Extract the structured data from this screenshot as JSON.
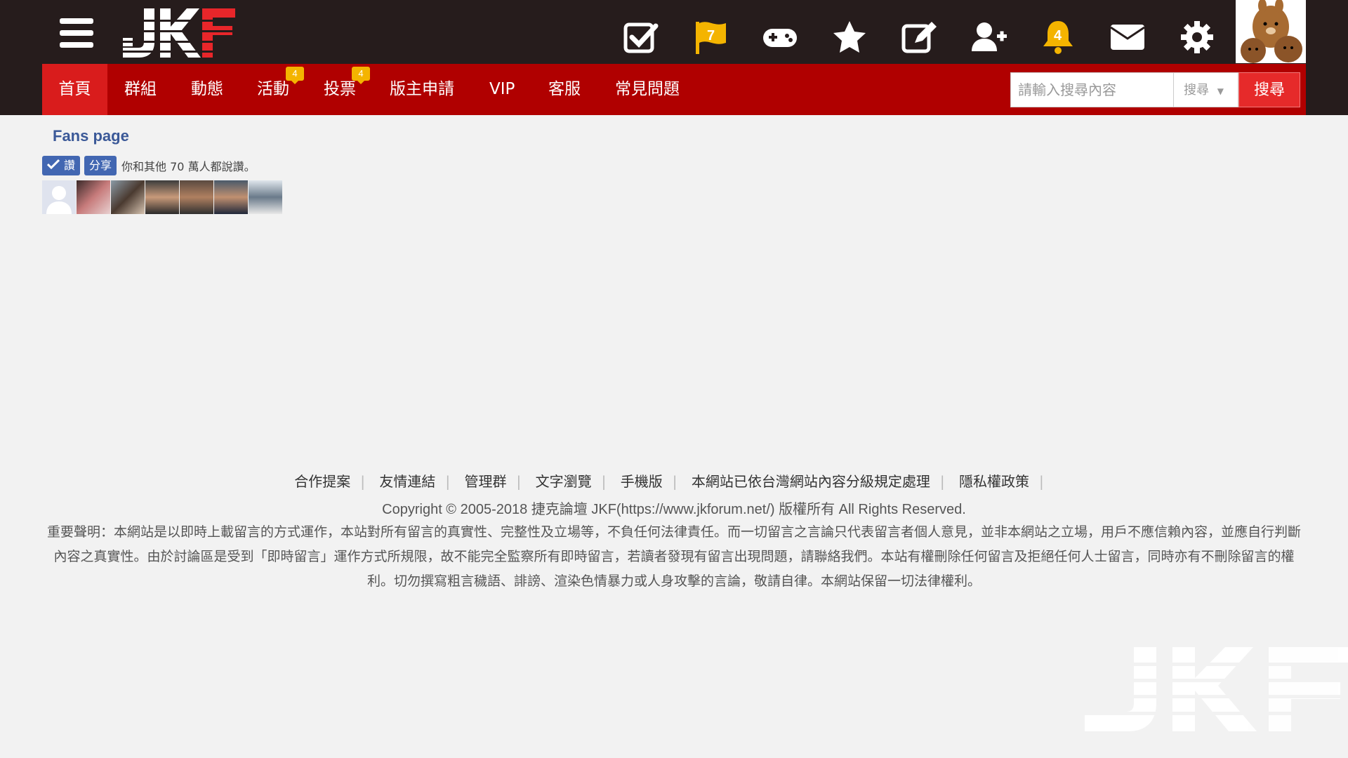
{
  "header": {
    "menu_icon": "hamburger-menu-icon",
    "logo_text": "JKF",
    "flag_badge": "7",
    "bell_badge": "4",
    "icons": [
      "checkbox-icon",
      "flag-icon",
      "gamepad-icon",
      "star-icon",
      "edit-icon",
      "add-friend-icon",
      "bell-icon",
      "mail-icon",
      "gear-icon"
    ]
  },
  "nav": {
    "items": [
      {
        "label": "首頁"
      },
      {
        "label": "群組"
      },
      {
        "label": "動態"
      },
      {
        "label": "活動",
        "badge": "4"
      },
      {
        "label": "投票",
        "badge": "4"
      },
      {
        "label": "版主申請"
      },
      {
        "label": "VIP"
      },
      {
        "label": "客服"
      },
      {
        "label": "常見問題"
      }
    ]
  },
  "search": {
    "placeholder": "請輸入搜尋內容",
    "type": "搜尋",
    "button": "搜尋"
  },
  "fans": {
    "title": "Fans page",
    "like_label": "讚",
    "share_label": "分享",
    "like_text": "你和其他 70 萬人都說讚。"
  },
  "footer": {
    "links": [
      "合作提案",
      "友情連結",
      "管理群",
      "文字瀏覽",
      "手機版",
      "本網站已依台灣網站內容分級規定處理",
      "隱私權政策"
    ],
    "copyright": "Copyright © 2005-2018 捷克論壇 JKF(https://www.jkforum.net/) 版權所有 All Rights Reserved.",
    "disclaimer": "重要聲明：本網站是以即時上載留言的方式運作，本站對所有留言的真實性、完整性及立場等，不負任何法律責任。而一切留言之言論只代表留言者個人意見，並非本網站之立場，用戶不應信賴內容，並應自行判斷內容之真實性。由於討論區是受到「即時留言」運作方式所規限，故不能完全監察所有即時留言，若讀者發現有留言出現問題，請聯絡我們。本站有權刪除任何留言及拒絕任何人士留言，同時亦有不刪除留言的權利。切勿撰寫粗言穢語、誹謗、渲染色情暴力或人身攻擊的言論，敬請自律。本網站保留一切法律權利。"
  },
  "colors": {
    "topbar": "#261c1c",
    "nav": "#b00000",
    "accent": "#e62a2a",
    "facebook": "#4267b2",
    "badge": "#f4b400"
  }
}
